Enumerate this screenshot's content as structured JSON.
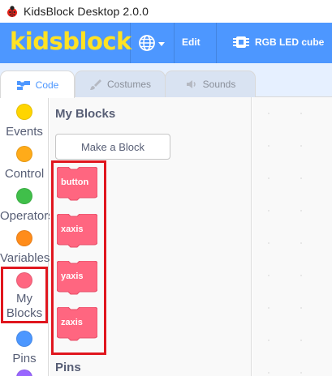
{
  "window": {
    "title": "KidsBlock Desktop 2.0.0"
  },
  "menubar": {
    "logo": "kidsblock",
    "edit_label": "Edit",
    "device_label": "RGB LED cube",
    "colors": {
      "bar": "#4d97ff",
      "logo": "#ffe224"
    }
  },
  "tabs": [
    {
      "label": "Code",
      "icon": "code-icon",
      "active": true
    },
    {
      "label": "Costumes",
      "icon": "brush-icon",
      "active": false
    },
    {
      "label": "Sounds",
      "icon": "speaker-icon",
      "active": false
    }
  ],
  "categories": [
    {
      "label": "Events",
      "color": "#ffd500"
    },
    {
      "label": "Control",
      "color": "#ffab19"
    },
    {
      "label": "Operators",
      "color": "#40bf4a"
    },
    {
      "label": "Variables",
      "color": "#ff8c1a"
    },
    {
      "label_line1": "My",
      "label_line2": "Blocks",
      "color": "#ff6680"
    },
    {
      "label": "Pins",
      "color": "#4c97ff"
    }
  ],
  "flyout": {
    "section_title": "My Blocks",
    "make_block_label": "Make a Block",
    "blocks": [
      "button",
      "xaxis",
      "yaxis",
      "zaxis"
    ],
    "next_section_title": "Pins",
    "block_color": "#ff6680"
  }
}
